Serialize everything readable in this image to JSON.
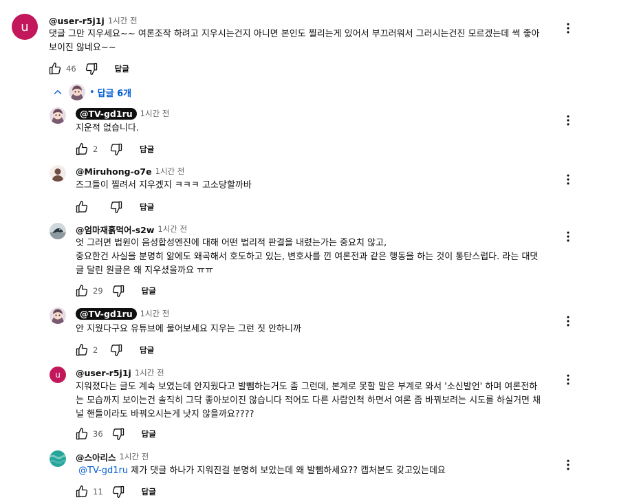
{
  "top_comment": {
    "avatar_letter": "u",
    "author": "@user-r5j1j",
    "time": "1시간 전",
    "text_line1": "댓글 그만 지우세요~~ 여론조작 하려고 지우시는건지 아니면 본인도 찔리는게 있어서 부끄러워서 그러시는건진 모르겠는데 썩 좋아",
    "text_line2": "보이진 않네요~~",
    "likes": "46",
    "reply_label": "답글"
  },
  "replies_toggle": {
    "label": "답글 6개"
  },
  "replies": [
    {
      "author": "@TV-gd1ru",
      "time": "1시간 전",
      "lines": [
        "지운적 없습니다."
      ],
      "likes": "2",
      "reply_label": "답글"
    },
    {
      "author": "@Miruhong-o7e",
      "time": "1시간 전",
      "lines": [
        "즈그들이 찔려서 지우겠지 ㅋㅋㅋ 고소당할까바"
      ],
      "likes": "",
      "reply_label": "답글"
    },
    {
      "author": "@엄마재흙먹어-s2w",
      "time": "1시간 전",
      "lines": [
        "엇 그러면 법원이 음성합성엔진에 대해 어떤 법리적 판결을 내렸는가는 중요치 않고,",
        "중요한건 사실을 분명히 앎에도 왜곡해서 호도하고 있는, 변호사를 낀 여론전과 같은 행동을 하는 것이 통탄스럽다. 라는 대댓",
        "글 달린 원글은 왜 지우셨을까요 ㅠㅠ"
      ],
      "likes": "29",
      "reply_label": "답글"
    },
    {
      "author": "@TV-gd1ru",
      "time": "1시간 전",
      "lines": [
        "안 지웠다구요 유튜브에 물어보세요 지우는 그런 짓 안하니까"
      ],
      "likes": "2",
      "reply_label": "답글"
    },
    {
      "avatar_letter": "u",
      "author": "@user-r5j1j",
      "time": "1시간 전",
      "lines": [
        "지워졌다는 글도 계속 보였는데 안지웠다고 발뺌하는거도 좀 그런데, 본계로 못할 말은 부계로 와서 '소신발언' 하며 여론전하",
        "는 모습까지 보이는건 솔직히 그닥 좋아보이진 않습니다 적어도 다른 사람인척 하면서 여론 좀 바꿔보려는 시도를 하실거면 채",
        "널 핸들이라도 바꿔오시는게 낫지 않을까요????"
      ],
      "likes": "36",
      "reply_label": "답글"
    },
    {
      "author": "@스아리스",
      "time": "1시간 전",
      "mention": "@TV-gd1ru",
      "lines": [
        " 제가 댓글 하나가 지워진걸 분명히 보았는데 왜 발뺌하세요?? 캡처본도 갖고있는데요"
      ],
      "likes": "11",
      "reply_label": "답글"
    }
  ],
  "colors": {
    "link_blue": "#065fd4",
    "avatar_pink": "#c2185b",
    "chip_black": "#0f0f0f",
    "meta_gray": "#606060"
  },
  "icons": [
    "thumb-up-icon",
    "thumb-down-icon",
    "more-vert-icon",
    "chevron-up-icon"
  ]
}
